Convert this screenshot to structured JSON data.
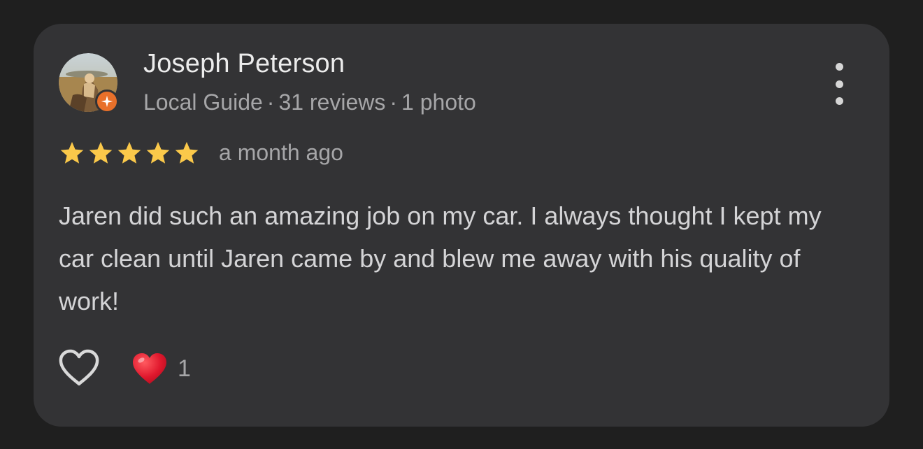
{
  "review": {
    "author": {
      "name": "Joseph Peterson",
      "level": "Local Guide",
      "reviews": "31 reviews",
      "photos": "1 photo",
      "separator": "·"
    },
    "rating": 5,
    "rating_max": 5,
    "time_ago": "a month ago",
    "text": "Jaren did such an amazing job on my car. I always thought I kept my car clean until Jaren came by and blew me away with his quality of work!",
    "reactions": {
      "like_icon": "heart-outline-icon",
      "reaction_icon": "red-heart-icon",
      "count": "1"
    },
    "menu_icon": "more-vertical-icon"
  },
  "colors": {
    "background": "#1f1f1f",
    "card": "#333335",
    "star": "#fbc94a",
    "badge": "#e8702a",
    "heart": "#e0182d"
  }
}
